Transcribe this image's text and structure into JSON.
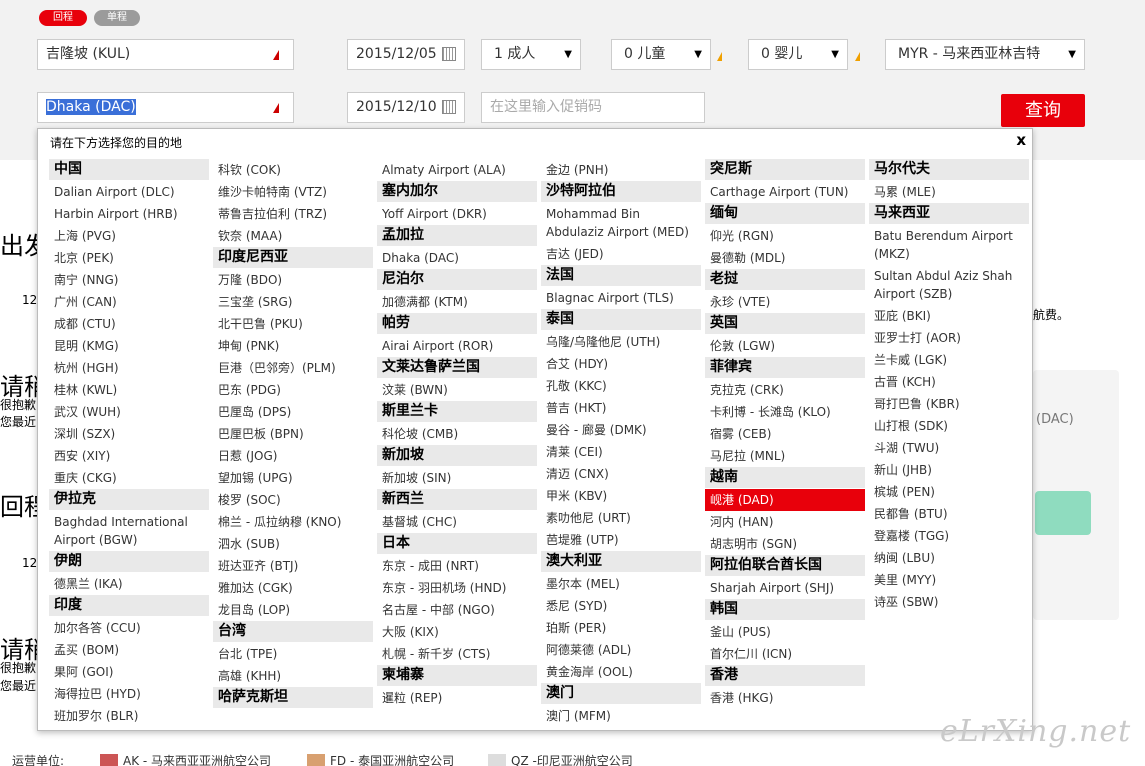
{
  "trip_type": {
    "return_label": "回程",
    "oneway_label": "单程"
  },
  "form": {
    "origin": "吉隆坡 (KUL)",
    "destination": "Dhaka (DAC)",
    "depart_date": "2015/12/05",
    "return_date": "2015/12/10",
    "adults": "1 成人",
    "children": "0 儿童",
    "infants": "0 婴儿",
    "currency": "MYR - 马来西亚林吉特",
    "promo_placeholder": "在这里输入促销码",
    "search_label": "查询"
  },
  "background": {
    "depart_heading": "出发",
    "return_heading": "回程",
    "date1": "12",
    "date2": "12",
    "notice1": "请稍",
    "notice1_line1": "很抱歉",
    "notice1_line2": "您最近的",
    "notice2": "请稍",
    "notice2_line1": "很抱歉",
    "notice2_line2": "您最近的",
    "fee_text": "航费。",
    "dac_text": "(DAC)"
  },
  "panel": {
    "title": "请在下方选择您的目的地",
    "close": "x",
    "columns": [
      [
        {
          "t": "country",
          "v": "中国"
        },
        {
          "t": "item",
          "v": "Dalian Airport (DLC)"
        },
        {
          "t": "item",
          "v": "Harbin Airport (HRB)"
        },
        {
          "t": "item",
          "v": "上海 (PVG)"
        },
        {
          "t": "item",
          "v": "北京 (PEK)"
        },
        {
          "t": "item",
          "v": "南宁 (NNG)"
        },
        {
          "t": "item",
          "v": "广州 (CAN)"
        },
        {
          "t": "item",
          "v": "成都 (CTU)"
        },
        {
          "t": "item",
          "v": "昆明 (KMG)"
        },
        {
          "t": "item",
          "v": "杭州 (HGH)"
        },
        {
          "t": "item",
          "v": "桂林 (KWL)"
        },
        {
          "t": "item",
          "v": "武汉 (WUH)"
        },
        {
          "t": "item",
          "v": "深圳 (SZX)"
        },
        {
          "t": "item",
          "v": "西安 (XIY)"
        },
        {
          "t": "item",
          "v": "重庆 (CKG)"
        },
        {
          "t": "country",
          "v": "伊拉克"
        },
        {
          "t": "wrap",
          "v": "Baghdad International Airport (BGW)"
        },
        {
          "t": "country",
          "v": "伊朗"
        },
        {
          "t": "item",
          "v": "德黑兰 (IKA)"
        },
        {
          "t": "country",
          "v": "印度"
        },
        {
          "t": "item",
          "v": "加尔各答 (CCU)"
        },
        {
          "t": "item",
          "v": "孟买 (BOM)"
        },
        {
          "t": "item",
          "v": "果阿 (GOI)"
        },
        {
          "t": "item",
          "v": "海得拉巴 (HYD)"
        },
        {
          "t": "item",
          "v": "班加罗尔 (BLR)"
        }
      ],
      [
        {
          "t": "item",
          "v": "科钦 (COK)"
        },
        {
          "t": "item",
          "v": "维沙卡帕特南 (VTZ)"
        },
        {
          "t": "item",
          "v": "蒂鲁吉拉伯利 (TRZ)"
        },
        {
          "t": "item",
          "v": "钦奈 (MAA)"
        },
        {
          "t": "country",
          "v": "印度尼西亚"
        },
        {
          "t": "item",
          "v": "万隆 (BDO)"
        },
        {
          "t": "item",
          "v": "三宝垄 (SRG)"
        },
        {
          "t": "item",
          "v": "北干巴鲁 (PKU)"
        },
        {
          "t": "item",
          "v": "坤甸 (PNK)"
        },
        {
          "t": "item",
          "v": "巨港（巴邻旁）(PLM)"
        },
        {
          "t": "item",
          "v": "巴东 (PDG)"
        },
        {
          "t": "item",
          "v": "巴厘岛 (DPS)"
        },
        {
          "t": "item",
          "v": "巴厘巴板 (BPN)"
        },
        {
          "t": "item",
          "v": "日惹 (JOG)"
        },
        {
          "t": "item",
          "v": "望加锡 (UPG)"
        },
        {
          "t": "item",
          "v": "梭罗 (SOC)"
        },
        {
          "t": "item",
          "v": "棉兰 - 瓜拉纳穆 (KNO)"
        },
        {
          "t": "item",
          "v": "泗水 (SUB)"
        },
        {
          "t": "item",
          "v": "班达亚齐 (BTJ)"
        },
        {
          "t": "item",
          "v": "雅加达 (CGK)"
        },
        {
          "t": "item",
          "v": "龙目岛 (LOP)"
        },
        {
          "t": "country",
          "v": "台湾"
        },
        {
          "t": "item",
          "v": "台北 (TPE)"
        },
        {
          "t": "item",
          "v": "高雄 (KHH)"
        },
        {
          "t": "country",
          "v": "哈萨克斯坦"
        }
      ],
      [
        {
          "t": "item",
          "v": "Almaty Airport (ALA)"
        },
        {
          "t": "country",
          "v": "塞内加尔"
        },
        {
          "t": "item",
          "v": "Yoff Airport (DKR)"
        },
        {
          "t": "country",
          "v": "孟加拉"
        },
        {
          "t": "item",
          "v": "Dhaka (DAC)"
        },
        {
          "t": "country",
          "v": "尼泊尔"
        },
        {
          "t": "item",
          "v": "加德满都 (KTM)"
        },
        {
          "t": "country",
          "v": "帕劳"
        },
        {
          "t": "item",
          "v": "Airai Airport (ROR)"
        },
        {
          "t": "country",
          "v": "文莱达鲁萨兰国"
        },
        {
          "t": "item",
          "v": "汶莱 (BWN)"
        },
        {
          "t": "country",
          "v": "斯里兰卡"
        },
        {
          "t": "item",
          "v": "科伦坡 (CMB)"
        },
        {
          "t": "country",
          "v": "新加坡"
        },
        {
          "t": "item",
          "v": "新加坡 (SIN)"
        },
        {
          "t": "country",
          "v": "新西兰"
        },
        {
          "t": "item",
          "v": "基督城 (CHC)"
        },
        {
          "t": "country",
          "v": "日本"
        },
        {
          "t": "item",
          "v": "东京 - 成田 (NRT)"
        },
        {
          "t": "item",
          "v": "东京 - 羽田机场 (HND)"
        },
        {
          "t": "item",
          "v": "名古屋 - 中部 (NGO)"
        },
        {
          "t": "item",
          "v": "大阪 (KIX)"
        },
        {
          "t": "item",
          "v": "札幌 - 新千岁 (CTS)"
        },
        {
          "t": "country",
          "v": "柬埔寨"
        },
        {
          "t": "item",
          "v": "暹粒 (REP)"
        }
      ],
      [
        {
          "t": "item",
          "v": "金边 (PNH)"
        },
        {
          "t": "country",
          "v": "沙特阿拉伯"
        },
        {
          "t": "wrap",
          "v": "Mohammad Bin Abdulaziz Airport (MED)"
        },
        {
          "t": "item",
          "v": "吉达 (JED)"
        },
        {
          "t": "country",
          "v": "法国"
        },
        {
          "t": "item",
          "v": "Blagnac Airport (TLS)"
        },
        {
          "t": "country",
          "v": "泰国"
        },
        {
          "t": "item",
          "v": "乌隆/乌隆他尼 (UTH)"
        },
        {
          "t": "item",
          "v": "合艾 (HDY)"
        },
        {
          "t": "item",
          "v": "孔敬 (KKC)"
        },
        {
          "t": "item",
          "v": "普吉 (HKT)"
        },
        {
          "t": "item",
          "v": "曼谷 - 廊曼 (DMK)"
        },
        {
          "t": "item",
          "v": "清莱 (CEI)"
        },
        {
          "t": "item",
          "v": "清迈 (CNX)"
        },
        {
          "t": "item",
          "v": "甲米 (KBV)"
        },
        {
          "t": "item",
          "v": "素叻他尼 (URT)"
        },
        {
          "t": "item",
          "v": "芭堤雅 (UTP)"
        },
        {
          "t": "country",
          "v": "澳大利亚"
        },
        {
          "t": "item",
          "v": "墨尔本 (MEL)"
        },
        {
          "t": "item",
          "v": "悉尼 (SYD)"
        },
        {
          "t": "item",
          "v": "珀斯 (PER)"
        },
        {
          "t": "item",
          "v": "阿德莱德 (ADL)"
        },
        {
          "t": "item",
          "v": "黄金海岸 (OOL)"
        },
        {
          "t": "country",
          "v": "澳门"
        },
        {
          "t": "item",
          "v": "澳门 (MFM)"
        }
      ],
      [
        {
          "t": "country",
          "v": "突尼斯"
        },
        {
          "t": "item",
          "v": "Carthage Airport (TUN)"
        },
        {
          "t": "country",
          "v": "缅甸"
        },
        {
          "t": "item",
          "v": "仰光 (RGN)"
        },
        {
          "t": "item",
          "v": "曼德勒 (MDL)"
        },
        {
          "t": "country",
          "v": "老挝"
        },
        {
          "t": "item",
          "v": "永珍 (VTE)"
        },
        {
          "t": "country",
          "v": "英国"
        },
        {
          "t": "item",
          "v": "伦敦 (LGW)"
        },
        {
          "t": "country",
          "v": "菲律宾"
        },
        {
          "t": "item",
          "v": "克拉克 (CRK)"
        },
        {
          "t": "item",
          "v": "卡利博 - 长滩岛 (KLO)"
        },
        {
          "t": "item",
          "v": "宿雾 (CEB)"
        },
        {
          "t": "item",
          "v": "马尼拉 (MNL)"
        },
        {
          "t": "country",
          "v": "越南"
        },
        {
          "t": "hl",
          "v": "岘港 (DAD)"
        },
        {
          "t": "item",
          "v": "河内 (HAN)"
        },
        {
          "t": "item",
          "v": "胡志明市 (SGN)"
        },
        {
          "t": "country",
          "v": "阿拉伯联合酋长国"
        },
        {
          "t": "item",
          "v": "Sharjah Airport (SHJ)"
        },
        {
          "t": "country",
          "v": "韩国"
        },
        {
          "t": "item",
          "v": "釜山 (PUS)"
        },
        {
          "t": "item",
          "v": "首尔仁川 (ICN)"
        },
        {
          "t": "country",
          "v": "香港"
        },
        {
          "t": "item",
          "v": "香港 (HKG)"
        }
      ],
      [
        {
          "t": "country",
          "v": "马尔代夫"
        },
        {
          "t": "item",
          "v": "马累 (MLE)"
        },
        {
          "t": "country",
          "v": "马来西亚"
        },
        {
          "t": "wrap",
          "v": "Batu Berendum Airport (MKZ)"
        },
        {
          "t": "wrap",
          "v": "Sultan Abdul Aziz Shah Airport (SZB)"
        },
        {
          "t": "item",
          "v": "亚庇 (BKI)"
        },
        {
          "t": "item",
          "v": "亚罗士打 (AOR)"
        },
        {
          "t": "item",
          "v": "兰卡威 (LGK)"
        },
        {
          "t": "item",
          "v": "古晋 (KCH)"
        },
        {
          "t": "item",
          "v": "哥打巴鲁 (KBR)"
        },
        {
          "t": "item",
          "v": "山打根 (SDK)"
        },
        {
          "t": "item",
          "v": "斗湖 (TWU)"
        },
        {
          "t": "item",
          "v": "新山 (JHB)"
        },
        {
          "t": "item",
          "v": "槟城 (PEN)"
        },
        {
          "t": "item",
          "v": "民都鲁 (BTU)"
        },
        {
          "t": "item",
          "v": "登嘉楼 (TGG)"
        },
        {
          "t": "item",
          "v": "纳闽 (LBU)"
        },
        {
          "t": "item",
          "v": "美里 (MYY)"
        },
        {
          "t": "item",
          "v": "诗巫 (SBW)"
        }
      ]
    ]
  },
  "footer": {
    "operator_label": "运营单位:",
    "ak": "AK - 马来西亚亚洲航空公司",
    "fd": "FD - 泰国亚洲航空公司",
    "qz": "QZ -印尼亚洲航空公司"
  },
  "watermark": "eLrXing.net",
  "colors": {
    "accent": "#e8000b",
    "highlight": "#e8000b",
    "country_bg": "#e9e9e9"
  }
}
